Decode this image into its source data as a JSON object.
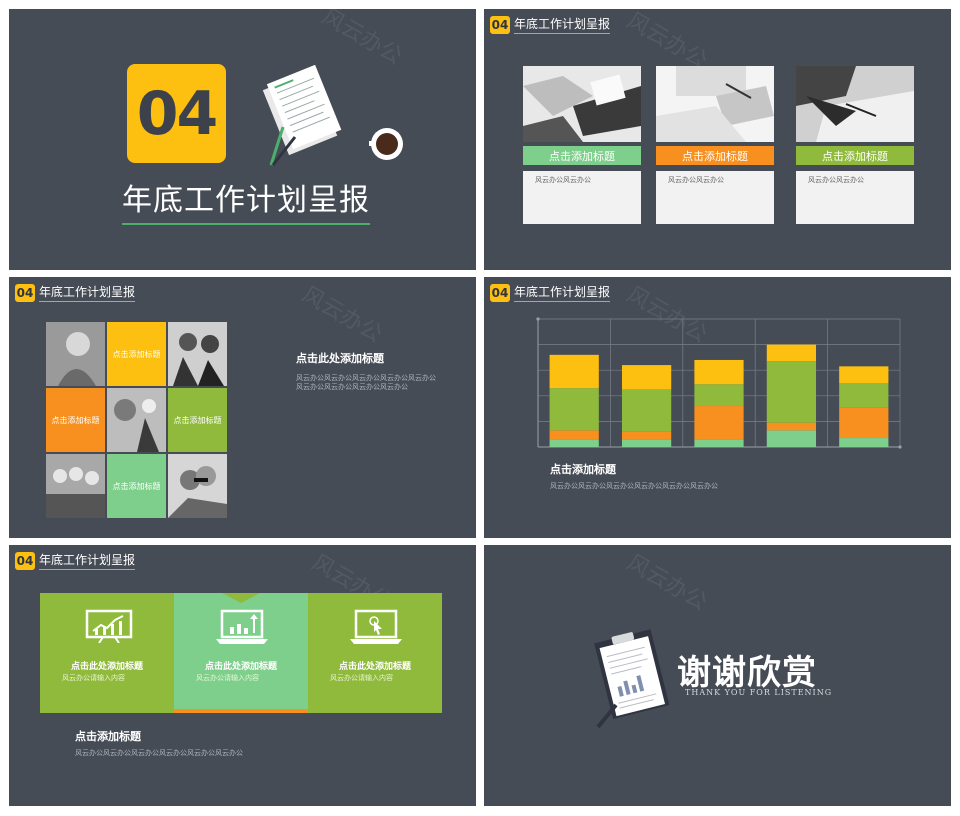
{
  "section_number": "04",
  "section_title": "年底工作计划呈报",
  "watermark": "风云办公",
  "colors": {
    "background": "#464c56",
    "yellow": "#fdbf10",
    "green": "#8fba3c",
    "light_green": "#7ecf8c",
    "orange": "#f7901e"
  },
  "slide2": {
    "cards": [
      {
        "caption": "点击添加标题",
        "body": "风云办公风云办公",
        "color": "#7ecf8c"
      },
      {
        "caption": "点击添加标题",
        "body": "风云办公风云办公",
        "color": "#f7901e"
      },
      {
        "caption": "点击添加标题",
        "body": "风云办公风云办公",
        "color": "#8fba3c"
      }
    ]
  },
  "slide3": {
    "cells": [
      "点击添加标题",
      "点击添加标题",
      "点击添加标题",
      "点击添加标题"
    ],
    "title": "点击此处添加标题",
    "body": "风云办公风云办公风云办公风云办公风云办公风云办公风云办公风云办公风云办公"
  },
  "slide4": {
    "title": "点击添加标题",
    "body": "风云办公风云办公风云办公风云办公风云办公风云办公",
    "chart_data": {
      "type": "bar",
      "stacked": true,
      "categories": [
        "",
        "",
        "",
        "",
        ""
      ],
      "series": [
        {
          "color": "#7ecf8c",
          "values": [
            6,
            6,
            6,
            13,
            7
          ]
        },
        {
          "color": "#f7901e",
          "values": [
            7,
            6,
            26,
            6,
            24
          ]
        },
        {
          "color": "#8fba3c",
          "values": [
            33,
            33,
            17,
            48,
            19
          ]
        },
        {
          "color": "#fdbf10",
          "values": [
            26,
            19,
            19,
            13,
            13
          ]
        }
      ],
      "ylim": [
        0,
        100
      ],
      "grid": true
    }
  },
  "slide5": {
    "panels": [
      {
        "title": "点击此处添加标题",
        "body": "风云办公请输入内容",
        "icon": "chart-board-icon"
      },
      {
        "title": "点击此处添加标题",
        "body": "风云办公请输入内容",
        "icon": "laptop-chart-icon"
      },
      {
        "title": "点击此处添加标题",
        "body": "风云办公请输入内容",
        "icon": "laptop-cursor-icon"
      }
    ],
    "title": "点击添加标题",
    "body": "风云办公风云办公风云办公风云办公风云办公风云办公"
  },
  "slide6": {
    "thanks": "谢谢欣赏",
    "subtitle": "THANK YOU FOR LISTENING"
  }
}
